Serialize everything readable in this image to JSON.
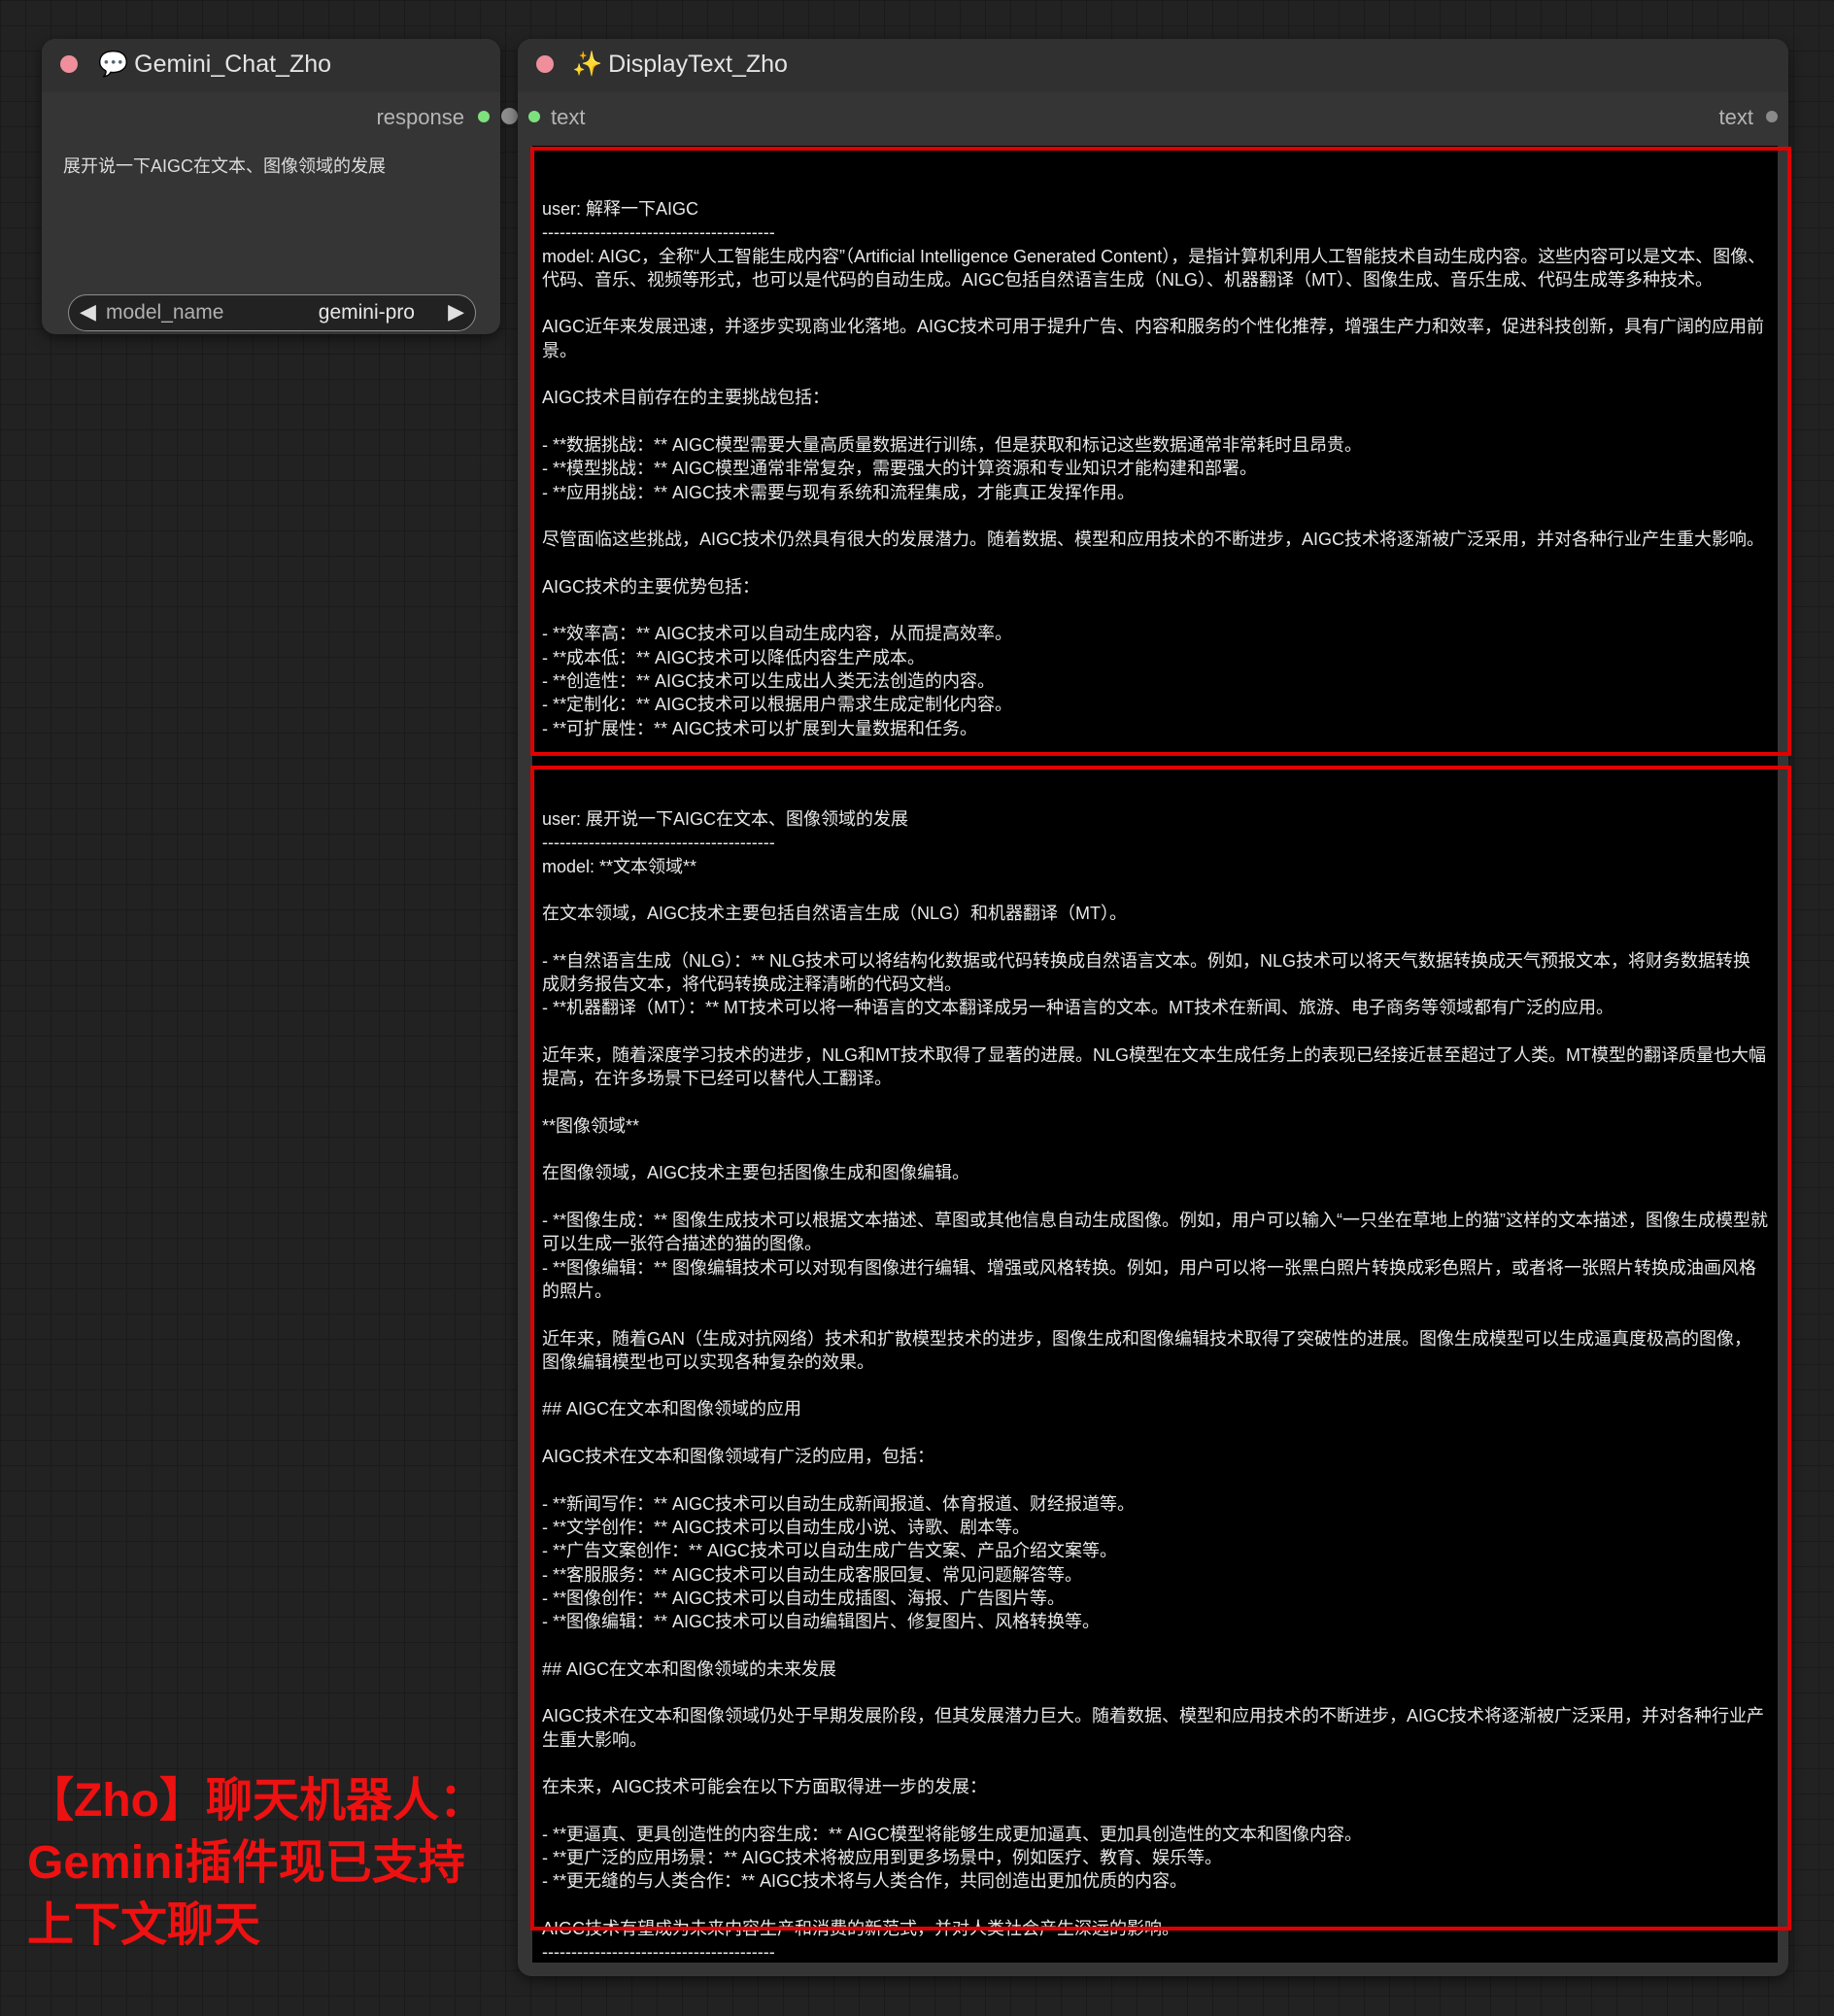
{
  "gemini_node": {
    "icon": "speech-bubble-icon",
    "title": "Gemini_Chat_Zho",
    "output_label": "response",
    "prompt_text": "展开说一下AIGC在文本、图像领域的发展",
    "model_widget": {
      "name": "model_name",
      "value": "gemini-pro"
    }
  },
  "display_node": {
    "icon": "sparkles-icon",
    "title": "DisplayText_Zho",
    "input_label": "text",
    "output_label": "text",
    "conversation": [
      {
        "text": "user: 解释一下AIGC\n----------------------------------------\nmodel: AIGC，全称“人工智能生成内容”（Artificial Intelligence Generated Content），是指计算机利用人工智能技术自动生成内容。这些内容可以是文本、图像、代码、音乐、视频等形式，也可以是代码的自动生成。AIGC包括自然语言生成（NLG）、机器翻译（MT）、图像生成、音乐生成、代码生成等多种技术。\n\nAIGC近年来发展迅速，并逐步实现商业化落地。AIGC技术可用于提升广告、内容和服务的个性化推荐，增强生产力和效率，促进科技创新，具有广阔的应用前景。\n\nAIGC技术目前存在的主要挑战包括：\n\n- **数据挑战：** AIGC模型需要大量高质量数据进行训练，但是获取和标记这些数据通常非常耗时且昂贵。\n- **模型挑战：** AIGC模型通常非常复杂，需要强大的计算资源和专业知识才能构建和部署。\n- **应用挑战：** AIGC技术需要与现有系统和流程集成，才能真正发挥作用。\n\n尽管面临这些挑战，AIGC技术仍然具有很大的发展潜力。随着数据、模型和应用技术的不断进步，AIGC技术将逐渐被广泛采用，并对各种行业产生重大影响。\n\nAIGC技术的主要优势包括：\n\n- **效率高：** AIGC技术可以自动生成内容，从而提高效率。\n- **成本低：** AIGC技术可以降低内容生产成本。\n- **创造性：** AIGC技术可以生成出人类无法创造的内容。\n- **定制化：** AIGC技术可以根据用户需求生成定制化内容。\n- **可扩展性：** AIGC技术可以扩展到大量数据和任务。\n----------------------------------------"
      },
      {
        "text": "user: 展开说一下AIGC在文本、图像领域的发展\n----------------------------------------\nmodel: **文本领域**\n\n在文本领域，AIGC技术主要包括自然语言生成（NLG）和机器翻译（MT）。\n\n- **自然语言生成（NLG）：** NLG技术可以将结构化数据或代码转换成自然语言文本。例如，NLG技术可以将天气数据转换成天气预报文本，将财务数据转换成财务报告文本，将代码转换成注释清晰的代码文档。\n- **机器翻译（MT）：** MT技术可以将一种语言的文本翻译成另一种语言的文本。MT技术在新闻、旅游、电子商务等领域都有广泛的应用。\n\n近年来，随着深度学习技术的进步，NLG和MT技术取得了显著的进展。NLG模型在文本生成任务上的表现已经接近甚至超过了人类。MT模型的翻译质量也大幅提高，在许多场景下已经可以替代人工翻译。\n\n**图像领域**\n\n在图像领域，AIGC技术主要包括图像生成和图像编辑。\n\n- **图像生成：** 图像生成技术可以根据文本描述、草图或其他信息自动生成图像。例如，用户可以输入“一只坐在草地上的猫”这样的文本描述，图像生成模型就可以生成一张符合描述的猫的图像。\n- **图像编辑：** 图像编辑技术可以对现有图像进行编辑、增强或风格转换。例如，用户可以将一张黑白照片转换成彩色照片，或者将一张照片转换成油画风格的照片。\n\n近年来，随着GAN（生成对抗网络）技术和扩散模型技术的进步，图像生成和图像编辑技术取得了突破性的进展。图像生成模型可以生成逼真度极高的图像，图像编辑模型也可以实现各种复杂的效果。\n\n## AIGC在文本和图像领域的应用\n\nAIGC技术在文本和图像领域有广泛的应用，包括：\n\n- **新闻写作：** AIGC技术可以自动生成新闻报道、体育报道、财经报道等。\n- **文学创作：** AIGC技术可以自动生成小说、诗歌、剧本等。\n- **广告文案创作：** AIGC技术可以自动生成广告文案、产品介绍文案等。\n- **客服服务：** AIGC技术可以自动生成客服回复、常见问题解答等。\n- **图像创作：** AIGC技术可以自动生成插图、海报、广告图片等。\n- **图像编辑：** AIGC技术可以自动编辑图片、修复图片、风格转换等。\n\n## AIGC在文本和图像领域的未来发展\n\nAIGC技术在文本和图像领域仍处于早期发展阶段，但其发展潜力巨大。随着数据、模型和应用技术的不断进步，AIGC技术将逐渐被广泛采用，并对各种行业产生重大影响。\n\n在未来，AIGC技术可能会在以下方面取得进一步的发展：\n\n- **更逼真、更具创造性的内容生成：** AIGC模型将能够生成更加逼真、更加具创造性的文本和图像内容。\n- **更广泛的应用场景：** AIGC技术将被应用到更多场景中，例如医疗、教育、娱乐等。\n- **更无缝的与人类合作：** AIGC技术将与人类合作，共同创造出更加优质的内容。\n\nAIGC技术有望成为未来内容生产和消费的新范式，并对人类社会产生深远的影响。\n----------------------------------------"
      }
    ]
  },
  "caption": {
    "line1": "【Zho】聊天机器人：",
    "line2": "Gemini插件现已支持",
    "line3": "上下文聊天"
  },
  "colors": {
    "highlight_frame": "#e00000",
    "caption": "#ee1111",
    "node_body": "#353535",
    "canvas": "#222222"
  }
}
